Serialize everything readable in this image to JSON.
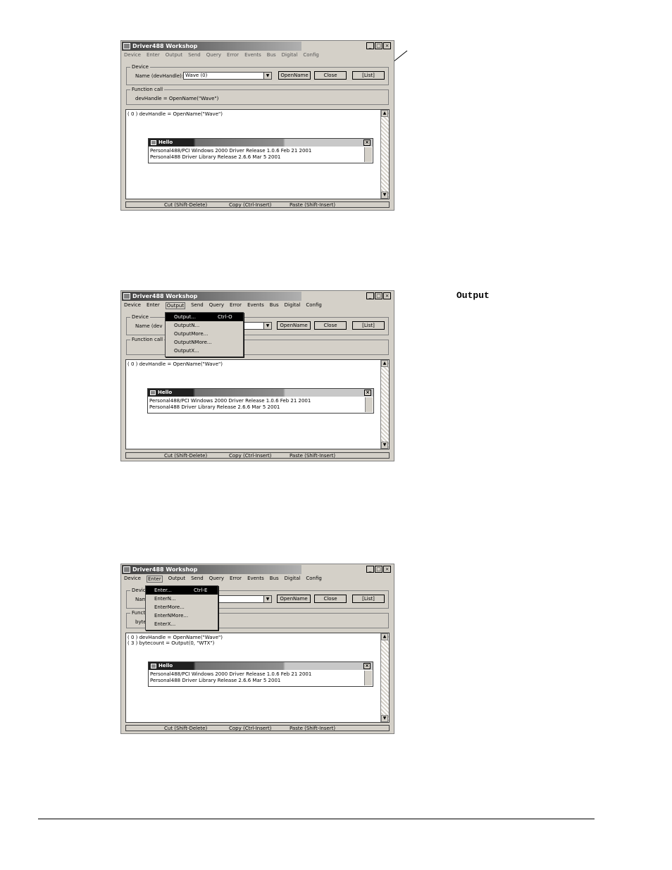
{
  "caption": "Output",
  "screenshots": [
    {
      "title": "Driver488 Workshop",
      "window_buttons": [
        "_",
        "□",
        "×"
      ],
      "menus": [
        "Device",
        "Enter",
        "Output",
        "Send",
        "Query",
        "Error",
        "Events",
        "Bus",
        "Digital",
        "Config"
      ],
      "active_menu": "",
      "device_group_label": "Device",
      "name_label": "Name (devHandle):",
      "name_value": "Wave  (0)",
      "buttons": [
        "OpenName",
        "Close",
        "[List]"
      ],
      "function_group_label": "Function call",
      "function_text": "devHandle = OpenName(\"Wave\")",
      "log_lines": [
        "( 0 )  devHandle = OpenName(\"Wave\")"
      ],
      "hello_title": "Hello",
      "hello_lines": [
        "Personal488/PCI Windows 2000 Driver Release 1.0.6  Feb 21 2001",
        "Personal488 Driver Library Release 2.6.6 Mar  5 2001"
      ],
      "status_items": [
        "Cut (Shift-Delete)",
        "Copy (Ctrl-Insert)",
        "Paste (Shift-Insert)"
      ]
    },
    {
      "title": "Driver488 Workshop",
      "window_buttons": [
        "_",
        "□",
        "×"
      ],
      "menus": [
        "Device",
        "Enter",
        "Output",
        "Send",
        "Query",
        "Error",
        "Events",
        "Bus",
        "Digital",
        "Config"
      ],
      "active_menu": "Output",
      "device_group_label": "Device",
      "name_label": "Name (dev",
      "name_value": "",
      "buttons": [
        "OpenName",
        "Close",
        "[List]"
      ],
      "function_group_label": "Function call",
      "function_text": "",
      "log_lines": [
        "( 0 )  devHandle = OpenName(\"Wave\")"
      ],
      "hello_title": "Hello",
      "hello_lines": [
        "Personal488/PCI Windows 2000 Driver Release 1.0.6  Feb 21 2001",
        "Personal488 Driver Library Release 2.6.6 Mar  5 2001"
      ],
      "status_items": [
        "Cut (Shift-Delete)",
        "Copy (Ctrl-Insert)",
        "Paste (Shift-Insert)"
      ],
      "dropdown": [
        {
          "label": "Output...",
          "shortcut": "Ctrl-O"
        },
        {
          "label": "OutputN...",
          "shortcut": ""
        },
        {
          "label": "OutputMore...",
          "shortcut": ""
        },
        {
          "label": "OutputNMore...",
          "shortcut": ""
        },
        {
          "label": "OutputX...",
          "shortcut": ""
        }
      ]
    },
    {
      "title": "Driver488 Workshop",
      "window_buttons": [
        "_",
        "□",
        "×"
      ],
      "menus": [
        "Device",
        "Enter",
        "Output",
        "Send",
        "Query",
        "Error",
        "Events",
        "Bus",
        "Digital",
        "Config"
      ],
      "active_menu": "Enter",
      "device_group_label": "Devic",
      "name_label": "Nam",
      "name_value": "",
      "buttons": [
        "OpenName",
        "Close",
        "[List]"
      ],
      "function_group_label": "Functi",
      "function_text": "byte",
      "log_lines": [
        "( 0 )  devHandle = OpenName(\"Wave\")",
        "( 3 )  bytecount = Output(0, \"WTX\")"
      ],
      "hello_title": "Hello",
      "hello_lines": [
        "Personal488/PCI Windows 2000 Driver Release 1.0.6  Feb 21 2001",
        "Personal488 Driver Library Release 2.6.6 Mar  5 2001"
      ],
      "status_items": [
        "Cut (Shift-Delete)",
        "Copy (Ctrl-Insert)",
        "Paste (Shift-Insert)"
      ],
      "dropdown": [
        {
          "label": "Enter...",
          "shortcut": "Ctrl-E"
        },
        {
          "label": "EnterN...",
          "shortcut": ""
        },
        {
          "label": "EnterMore...",
          "shortcut": ""
        },
        {
          "label": "EnterNMore...",
          "shortcut": ""
        },
        {
          "label": "EnterX...",
          "shortcut": ""
        }
      ]
    }
  ]
}
